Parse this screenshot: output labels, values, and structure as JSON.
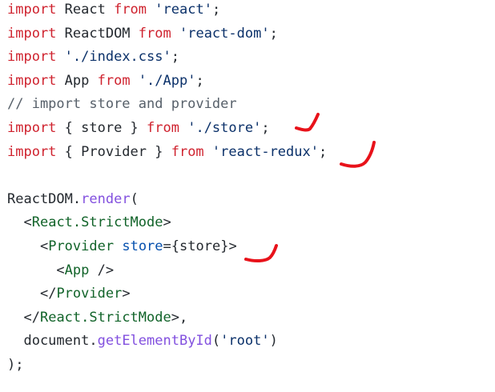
{
  "colors": {
    "background": "#ffffff",
    "keyword": "#cf222e",
    "string": "#0a3069",
    "comment": "#57606a",
    "text": "#24292f",
    "tag": "#116329",
    "function": "#8250df",
    "attribute": "#0550ae",
    "annotation": "#e8121a"
  },
  "code": {
    "lines": [
      [
        {
          "t": "import",
          "c": "keyword"
        },
        {
          "t": " React ",
          "c": "text"
        },
        {
          "t": "from",
          "c": "keyword"
        },
        {
          "t": " ",
          "c": "text"
        },
        {
          "t": "'react'",
          "c": "string"
        },
        {
          "t": ";",
          "c": "text"
        }
      ],
      [
        {
          "t": "import",
          "c": "keyword"
        },
        {
          "t": " ReactDOM ",
          "c": "text"
        },
        {
          "t": "from",
          "c": "keyword"
        },
        {
          "t": " ",
          "c": "text"
        },
        {
          "t": "'react-dom'",
          "c": "string"
        },
        {
          "t": ";",
          "c": "text"
        }
      ],
      [
        {
          "t": "import",
          "c": "keyword"
        },
        {
          "t": " ",
          "c": "text"
        },
        {
          "t": "'./index.css'",
          "c": "string"
        },
        {
          "t": ";",
          "c": "text"
        }
      ],
      [
        {
          "t": "import",
          "c": "keyword"
        },
        {
          "t": " App ",
          "c": "text"
        },
        {
          "t": "from",
          "c": "keyword"
        },
        {
          "t": " ",
          "c": "text"
        },
        {
          "t": "'./App'",
          "c": "string"
        },
        {
          "t": ";",
          "c": "text"
        }
      ],
      [
        {
          "t": "// import store and provider",
          "c": "comment"
        }
      ],
      [
        {
          "t": "import",
          "c": "keyword"
        },
        {
          "t": " { store } ",
          "c": "text"
        },
        {
          "t": "from",
          "c": "keyword"
        },
        {
          "t": " ",
          "c": "text"
        },
        {
          "t": "'./store'",
          "c": "string"
        },
        {
          "t": ";",
          "c": "text"
        }
      ],
      [
        {
          "t": "import",
          "c": "keyword"
        },
        {
          "t": " { Provider } ",
          "c": "text"
        },
        {
          "t": "from",
          "c": "keyword"
        },
        {
          "t": " ",
          "c": "text"
        },
        {
          "t": "'react-redux'",
          "c": "string"
        },
        {
          "t": ";",
          "c": "text"
        }
      ],
      [],
      [
        {
          "t": "ReactDOM",
          "c": "text"
        },
        {
          "t": ".",
          "c": "text"
        },
        {
          "t": "render",
          "c": "function"
        },
        {
          "t": "(",
          "c": "text"
        }
      ],
      [
        {
          "t": "  ",
          "c": "text"
        },
        {
          "t": "<",
          "c": "text"
        },
        {
          "t": "React.StrictMode",
          "c": "tag"
        },
        {
          "t": ">",
          "c": "text"
        }
      ],
      [
        {
          "t": "    ",
          "c": "text"
        },
        {
          "t": "<",
          "c": "text"
        },
        {
          "t": "Provider",
          "c": "tag"
        },
        {
          "t": " ",
          "c": "text"
        },
        {
          "t": "store",
          "c": "attribute"
        },
        {
          "t": "=",
          "c": "text"
        },
        {
          "t": "{store}",
          "c": "text"
        },
        {
          "t": ">",
          "c": "text"
        }
      ],
      [
        {
          "t": "      ",
          "c": "text"
        },
        {
          "t": "<",
          "c": "text"
        },
        {
          "t": "App",
          "c": "tag"
        },
        {
          "t": " />",
          "c": "text"
        }
      ],
      [
        {
          "t": "    ",
          "c": "text"
        },
        {
          "t": "</",
          "c": "text"
        },
        {
          "t": "Provider",
          "c": "tag"
        },
        {
          "t": ">",
          "c": "text"
        }
      ],
      [
        {
          "t": "  ",
          "c": "text"
        },
        {
          "t": "</",
          "c": "text"
        },
        {
          "t": "React.StrictMode",
          "c": "tag"
        },
        {
          "t": ">,",
          "c": "text"
        }
      ],
      [
        {
          "t": "  document",
          "c": "text"
        },
        {
          "t": ".",
          "c": "text"
        },
        {
          "t": "getElementById",
          "c": "function"
        },
        {
          "t": "(",
          "c": "text"
        },
        {
          "t": "'root'",
          "c": "string"
        },
        {
          "t": ")",
          "c": "text"
        }
      ],
      [
        {
          "t": ");",
          "c": "text"
        }
      ]
    ]
  },
  "annotations": {
    "marks": [
      "red-check",
      "red-check",
      "red-check"
    ]
  }
}
